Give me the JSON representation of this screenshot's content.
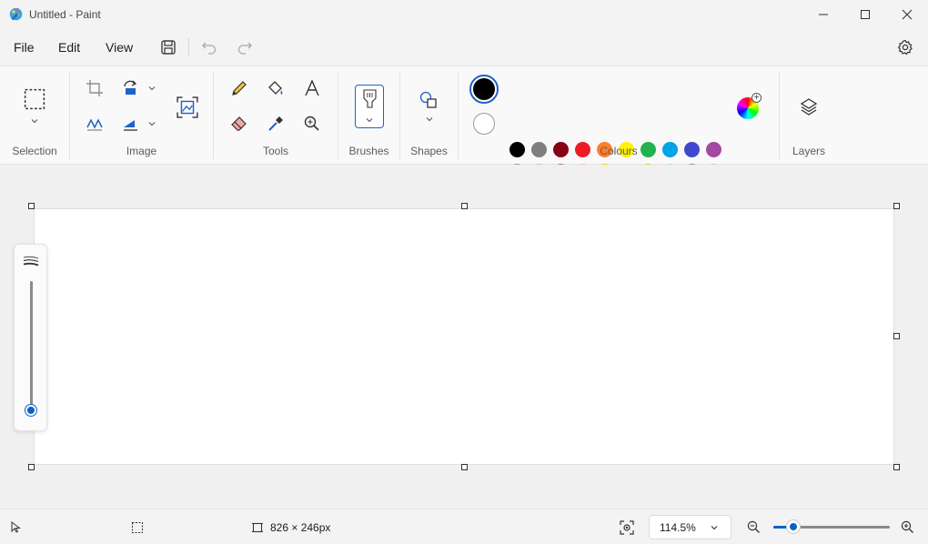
{
  "window": {
    "title": "Untitled - Paint"
  },
  "menu": {
    "file": "File",
    "edit": "Edit",
    "view": "View"
  },
  "ribbon": {
    "groups": {
      "selection": "Selection",
      "image": "Image",
      "tools": "Tools",
      "brushes": "Brushes",
      "shapes": "Shapes",
      "colours": "Colours",
      "layers": "Layers"
    },
    "colours": {
      "primary": "#000000",
      "secondary": "#ffffff",
      "row1": [
        "#000000",
        "#7f7f7f",
        "#880015",
        "#ed1c24",
        "#ff7f27",
        "#fff200",
        "#22b14c",
        "#00a2e8",
        "#3f48cc",
        "#a349a4"
      ],
      "row2": [
        "#ffffff",
        "#c3c3c3",
        "#b97a57",
        "#ffaec9",
        "#ffc90e",
        "#efe4b0",
        "#b5e61d",
        "#99d9ea",
        "#7092be",
        "#c8bfe7"
      ],
      "row3_empty_count": 10
    }
  },
  "brush_size": {
    "level": 0.0
  },
  "status": {
    "canvas_size": "826 × 246px",
    "zoom": "114.5%",
    "zoom_level": 0.17
  },
  "colors": {
    "accent": "#0a64c8"
  }
}
